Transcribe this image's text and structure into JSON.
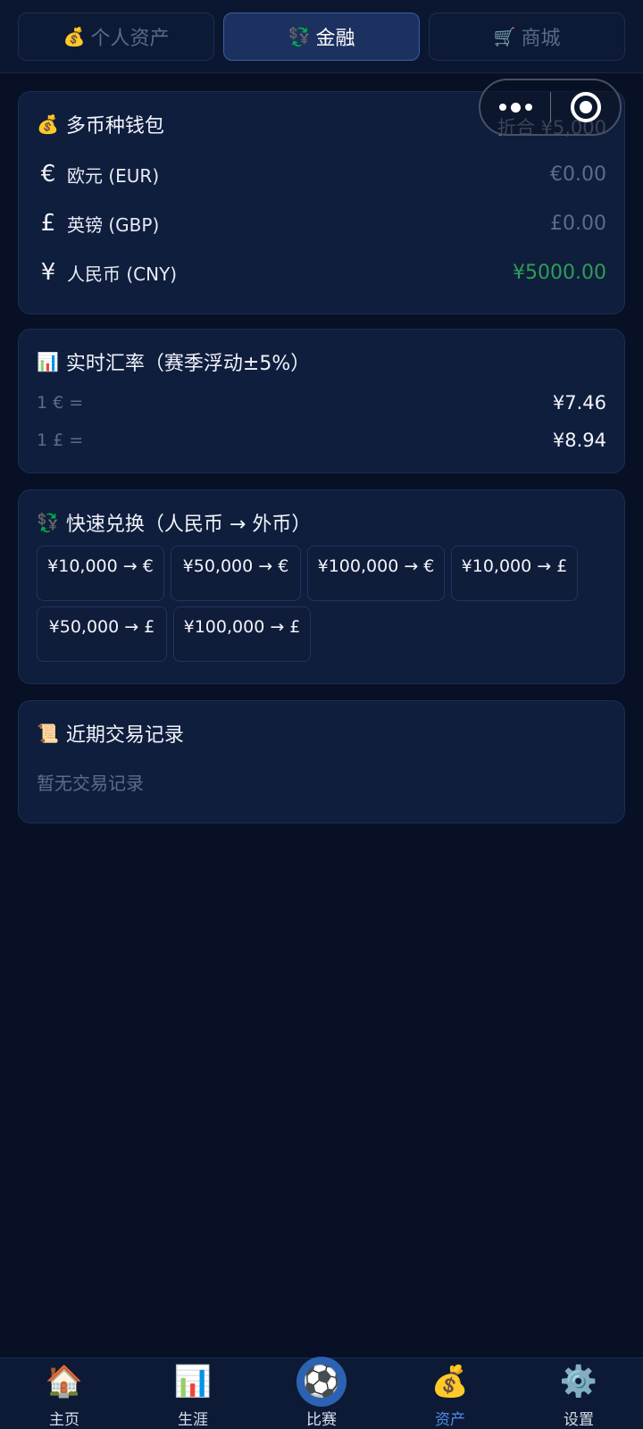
{
  "tabs": [
    {
      "icon": "💰",
      "label": "个人资产",
      "active": false
    },
    {
      "icon": "💱",
      "label": "金融",
      "active": true
    },
    {
      "icon": "🛒",
      "label": "商城",
      "active": false
    }
  ],
  "wallet": {
    "icon": "💰",
    "title": "多币种钱包",
    "total": "折合 ¥5,000",
    "rows": [
      {
        "symbol": "€",
        "label": "欧元 (EUR)",
        "amount": "€0.00"
      },
      {
        "symbol": "£",
        "label": "英镑 (GBP)",
        "amount": "£0.00"
      },
      {
        "symbol": "¥",
        "label": "人民币 (CNY)",
        "amount": "¥5000.00"
      }
    ]
  },
  "rates": {
    "icon": "📊",
    "title": "实时汇率（赛季浮动±5%）",
    "rows": [
      {
        "label": "1 € =",
        "value": "¥7.46"
      },
      {
        "label": "1 £ =",
        "value": "¥8.94"
      }
    ]
  },
  "exchange": {
    "icon": "💱",
    "title": "快速兑换（人民币 → 外币）",
    "buttons": [
      "¥10,000 → €",
      "¥50,000 → €",
      "¥100,000 → €",
      "¥10,000 → £",
      "¥50,000 → £",
      "¥100,000 → £"
    ]
  },
  "history": {
    "icon": "📜",
    "title": "近期交易记录",
    "empty": "暂无交易记录"
  },
  "bottom_nav": [
    {
      "icon": "🏠",
      "label": "主页",
      "active": false
    },
    {
      "icon": "📊",
      "label": "生涯",
      "active": false
    },
    {
      "icon": "⚽",
      "label": "比赛",
      "active": false
    },
    {
      "icon": "💰",
      "label": "资产",
      "active": true
    },
    {
      "icon": "⚙️",
      "label": "设置",
      "active": false
    }
  ]
}
